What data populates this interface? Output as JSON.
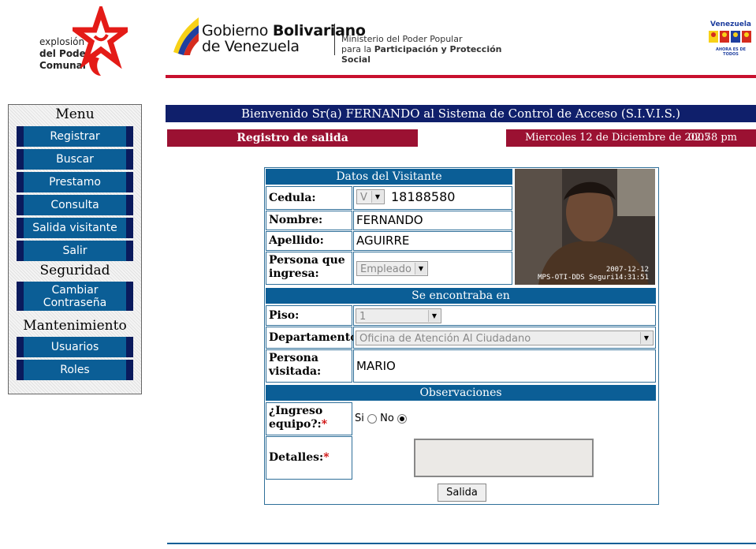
{
  "header": {
    "logo_left_lines": [
      "explosión",
      "del Poder",
      "Comunal"
    ],
    "gob_line1_prefix": "Gobierno ",
    "gob_line1_bold": "Bolivariano",
    "gob_line2": "de Venezuela",
    "ministry_line1": "Ministerio del Poder Popular",
    "ministry_line2_prefix": "para la ",
    "ministry_line2_bold": "Participación y Protección Social",
    "vzla_logo_text": "Venezuela",
    "vzla_logo_sub": "AHORA ES DE TODOS"
  },
  "sidebar": {
    "heading_menu": "Menu",
    "menu_items": [
      "Registrar",
      "Buscar",
      "Prestamo",
      "Consulta",
      "Salida visitante",
      "Salir"
    ],
    "heading_seguridad": "Seguridad",
    "seguridad_items": [
      "Cambiar Contraseña"
    ],
    "heading_mantenimiento": "Mantenimiento",
    "mantenimiento_items": [
      "Usuarios",
      "Roles"
    ]
  },
  "welcome": {
    "prefix": "Bienvenido Sr(a) ",
    "name": "FERNANDO",
    "suffix": " al Sistema de Control de Acceso (S.I.V.I.S.)"
  },
  "section_title": "Registro de salida",
  "datebar": {
    "date": "Miercoles 12 de Diciembre de 2007",
    "time": "02:58 pm"
  },
  "form": {
    "datos_heading": "Datos del Visitante",
    "cedula_label": "Cedula:",
    "cedula_type": "V",
    "cedula_value": "18188580",
    "nombre_label": "Nombre:",
    "nombre_value": "FERNANDO",
    "apellido_label": "Apellido:",
    "apellido_value": "AGUIRRE",
    "persona_label": "Persona que ingresa:",
    "persona_value": "Empleado",
    "se_encontraba_heading": "Se encontraba en",
    "piso_label": "Piso:",
    "piso_value": "1",
    "departamento_label": "Departamento:",
    "departamento_value": "Oficina de Atención Al Ciudadano",
    "visitada_label": "Persona visitada:",
    "visitada_value": "MARIO",
    "observaciones_heading": "Observaciones",
    "ingreso_label": "¿Ingreso equipo?:",
    "si_label": "Si",
    "no_label": "No",
    "ingreso_selected": "No",
    "detalles_label": "Detalles:",
    "required_mark": "*",
    "submit_label": "Salida"
  },
  "photo": {
    "stamp_date": "2007-12-12",
    "stamp_text": "MPS-OTI-DDS Seguri14:31:51"
  },
  "colors": {
    "nav_blue": "#0b5e96",
    "navy": "#0f1f6b",
    "maroon": "#9b1132",
    "red_line": "#c8102e"
  }
}
